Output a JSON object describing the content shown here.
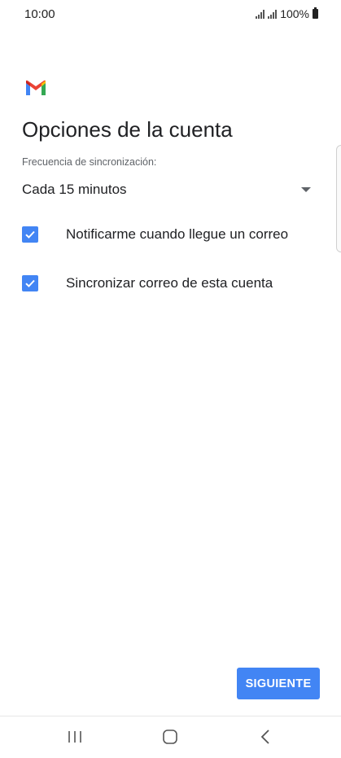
{
  "status_bar": {
    "time": "10:00",
    "battery_text": "100%"
  },
  "account_options": {
    "title": "Opciones de la cuenta",
    "sync_frequency_label": "Frecuencia de sincronización:",
    "sync_frequency_value": "Cada 15 minutos",
    "options": [
      {
        "label": "Notificarme cuando llegue un correo",
        "checked": true
      },
      {
        "label": "Sincronizar correo de esta cuenta",
        "checked": true
      }
    ]
  },
  "footer": {
    "next_label": "SIGUIENTE"
  },
  "icons": {
    "app_logo": "gmail-icon",
    "recent_apps": "recent-apps-icon",
    "home": "home-icon",
    "back": "back-icon"
  },
  "colors": {
    "accent": "#4285f4",
    "gmail_red": "#ea4335",
    "gmail_blue": "#4285f4",
    "gmail_green": "#34a853",
    "gmail_yellow": "#fbbc04"
  }
}
